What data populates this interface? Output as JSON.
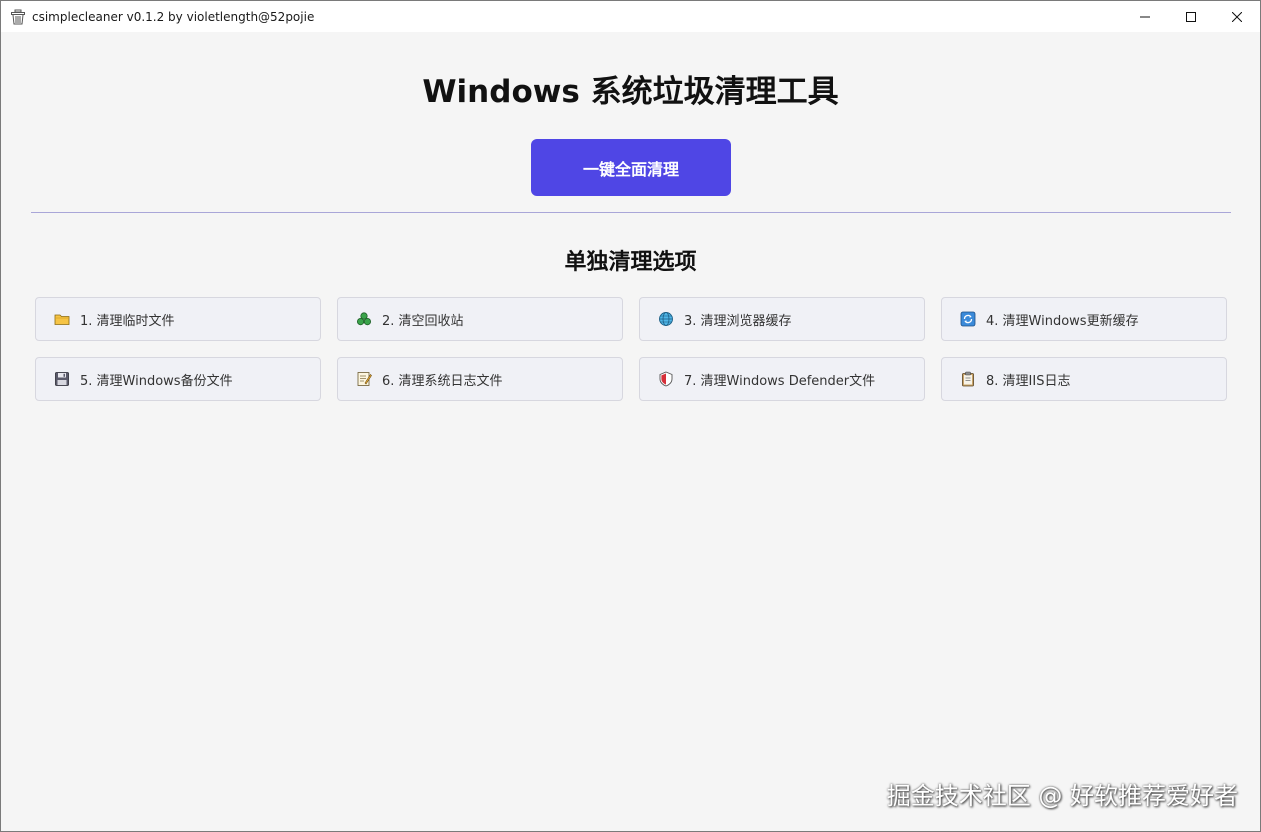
{
  "window": {
    "title": "csimplecleaner v0.1.2 by violetlength@52pojie",
    "icon": "trash-basket-icon"
  },
  "header": {
    "title": "Windows 系统垃圾清理工具",
    "clean_all_label": "一键全面清理",
    "accent_color": "#4f46e5"
  },
  "section": {
    "title": "单独清理选项"
  },
  "options": [
    {
      "label": "1. 清理临时文件",
      "icon": "folder-icon"
    },
    {
      "label": "2. 清空回收站",
      "icon": "recycle-icon"
    },
    {
      "label": "3. 清理浏览器缓存",
      "icon": "globe-icon"
    },
    {
      "label": "4. 清理Windows更新缓存",
      "icon": "refresh-icon"
    },
    {
      "label": "5. 清理Windows备份文件",
      "icon": "floppy-disk-icon"
    },
    {
      "label": "6. 清理系统日志文件",
      "icon": "memo-icon"
    },
    {
      "label": "7. 清理Windows Defender文件",
      "icon": "shield-icon"
    },
    {
      "label": "8. 清理IIS日志",
      "icon": "clipboard-icon"
    }
  ],
  "watermark": "掘金技术社区 @ 好软推荐爱好者"
}
